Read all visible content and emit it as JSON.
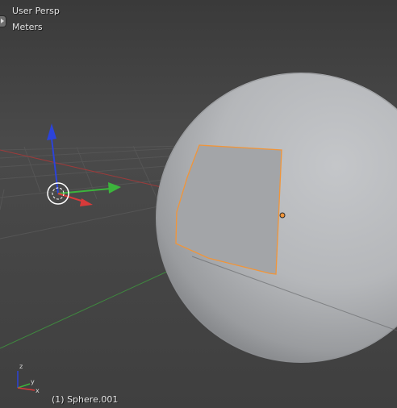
{
  "viewport": {
    "view_name": "User Persp",
    "units": "Meters",
    "active_object": "(1) Sphere.001"
  },
  "mini_axes": {
    "z_label": "z",
    "y_label": "y",
    "x_label": "x"
  },
  "colors": {
    "axis_x": "#d83a3a",
    "axis_y": "#3cb43c",
    "axis_z": "#2c43d9",
    "selection_outline": "#f0953a",
    "origin": "#f0953a"
  },
  "icons": {
    "side_tab": "toolshelf-expand-icon",
    "manipulator": "transform-manipulator-icon",
    "mini_axes": "view-axes-icon"
  }
}
